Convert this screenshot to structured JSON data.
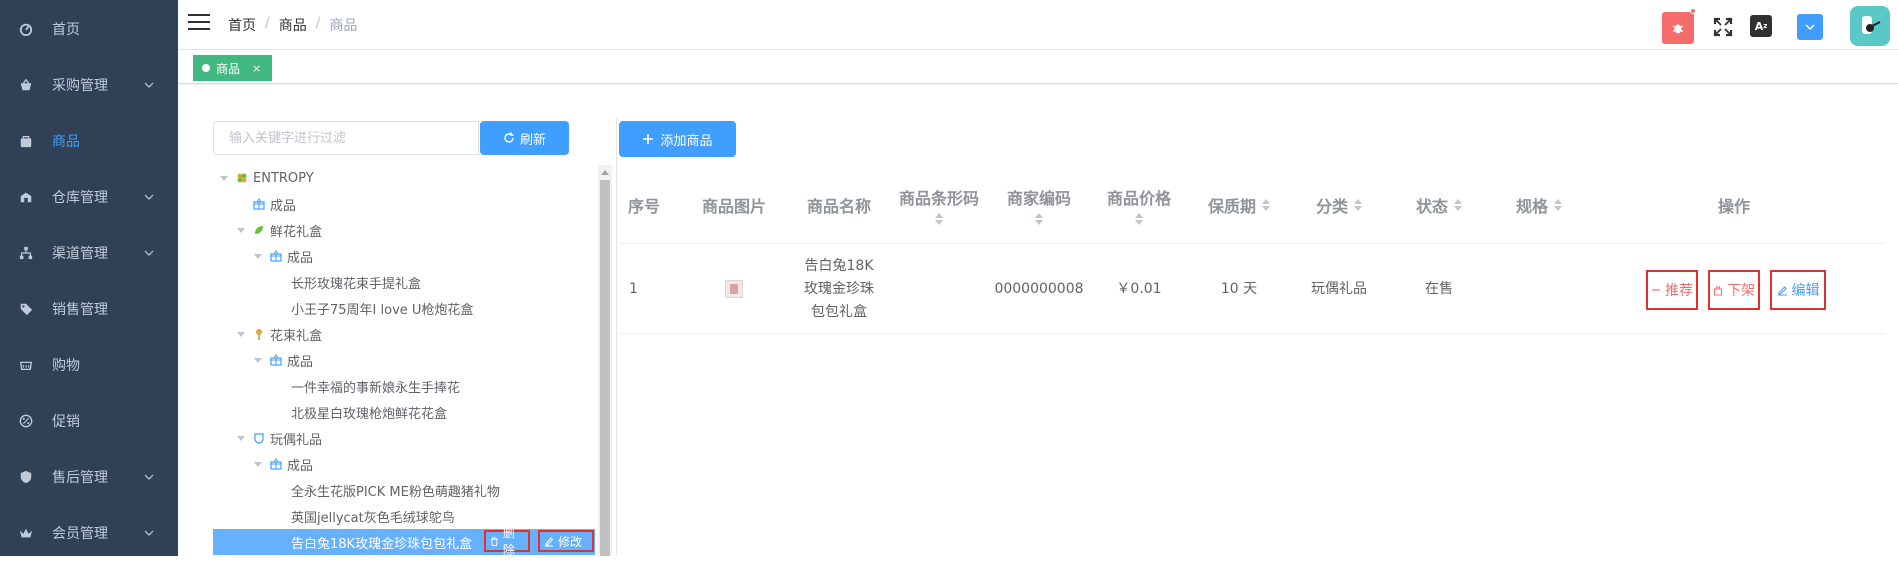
{
  "sidebar": {
    "items": [
      {
        "label": "首页",
        "icon": "dashboard-icon",
        "has_children": false,
        "active": false
      },
      {
        "label": "采购管理",
        "icon": "basket-icon",
        "has_children": true,
        "active": false
      },
      {
        "label": "商品",
        "icon": "bag-icon",
        "has_children": false,
        "active": true
      },
      {
        "label": "仓库管理",
        "icon": "warehouse-icon",
        "has_children": true,
        "active": false
      },
      {
        "label": "渠道管理",
        "icon": "network-icon",
        "has_children": true,
        "active": false
      },
      {
        "label": "销售管理",
        "icon": "tag-icon",
        "has_children": false,
        "active": false
      },
      {
        "label": "购物",
        "icon": "cart-icon",
        "has_children": false,
        "active": false
      },
      {
        "label": "促销",
        "icon": "percent-icon",
        "has_children": false,
        "active": false
      },
      {
        "label": "售后管理",
        "icon": "shield-icon",
        "has_children": true,
        "active": false
      },
      {
        "label": "会员管理",
        "icon": "crown-icon",
        "has_children": true,
        "active": false
      }
    ]
  },
  "breadcrumb": [
    "首页",
    "商品",
    "商品"
  ],
  "tags_view": {
    "active_tag": "商品",
    "close": "×"
  },
  "tree_panel": {
    "filter_placeholder": "输入关键字进行过滤",
    "refresh_label": "刷新",
    "nodes": [
      {
        "label": "ENTROPY",
        "level": 0,
        "expanded": true,
        "icon": "clover-icon"
      },
      {
        "label": "成品",
        "level": 1,
        "expanded": false,
        "icon": "gift-icon"
      },
      {
        "label": "鲜花礼盒",
        "level": 1,
        "expanded": true,
        "icon": "leaf-icon"
      },
      {
        "label": "成品",
        "level": 2,
        "expanded": true,
        "icon": "gift-icon"
      },
      {
        "label": "长形玫瑰花束手提礼盒",
        "level": 3
      },
      {
        "label": "小王子75周年I love U枪炮花盒",
        "level": 3
      },
      {
        "label": "花束礼盒",
        "level": 1,
        "expanded": true,
        "icon": "flower-icon"
      },
      {
        "label": "成品",
        "level": 2,
        "expanded": true,
        "icon": "gift-icon"
      },
      {
        "label": "一件幸福的事新娘永生手捧花",
        "level": 3
      },
      {
        "label": "北极星白玫瑰枪炮鲜花花盒",
        "level": 3
      },
      {
        "label": "玩偶礼品",
        "level": 1,
        "expanded": true,
        "icon": "toy-icon"
      },
      {
        "label": "成品",
        "level": 2,
        "expanded": true,
        "icon": "gift-icon"
      },
      {
        "label": "全永生花版PICK ME粉色萌趣猪礼物",
        "level": 3
      },
      {
        "label": "英国jellycat灰色毛绒球鸵鸟",
        "level": 3
      },
      {
        "label": "告白兔18K玫瑰金珍珠包包礼盒",
        "level": 3,
        "selected": true
      }
    ],
    "row_actions": {
      "delete_label": "删除",
      "modify_label": "修改"
    }
  },
  "table": {
    "add_button_label": "添加商品",
    "columns": [
      {
        "label": "序号",
        "sortable": false
      },
      {
        "label": "商品图片",
        "sortable": false
      },
      {
        "label": "商品名称",
        "sortable": false
      },
      {
        "label": "商品条形码",
        "sortable": true
      },
      {
        "label": "商家编码",
        "sortable": true
      },
      {
        "label": "商品价格",
        "sortable": true
      },
      {
        "label": "保质期",
        "sortable": true
      },
      {
        "label": "分类",
        "sortable": true
      },
      {
        "label": "状态",
        "sortable": true
      },
      {
        "label": "规格",
        "sortable": true
      },
      {
        "label": "操作",
        "sortable": false
      }
    ],
    "rows": [
      {
        "index": "1",
        "name_lines": [
          "告白兔18K",
          "玫瑰金珍珠",
          "包包礼盒"
        ],
        "barcode": "",
        "merchant_code": "0000000008",
        "price": "￥0.01",
        "shelf_life": "10 天",
        "category": "玩偶礼品",
        "status": "在售",
        "spec": "",
        "actions": {
          "recommend": "推荐",
          "unlist": "下架",
          "edit": "编辑"
        }
      }
    ]
  },
  "colors": {
    "sidebar_bg": "#304156",
    "sidebar_text": "#bfcbd9",
    "accent": "#409eff",
    "tag_green": "#42b983",
    "danger": "#f56c6c",
    "selected_row": "#66b1ff"
  }
}
